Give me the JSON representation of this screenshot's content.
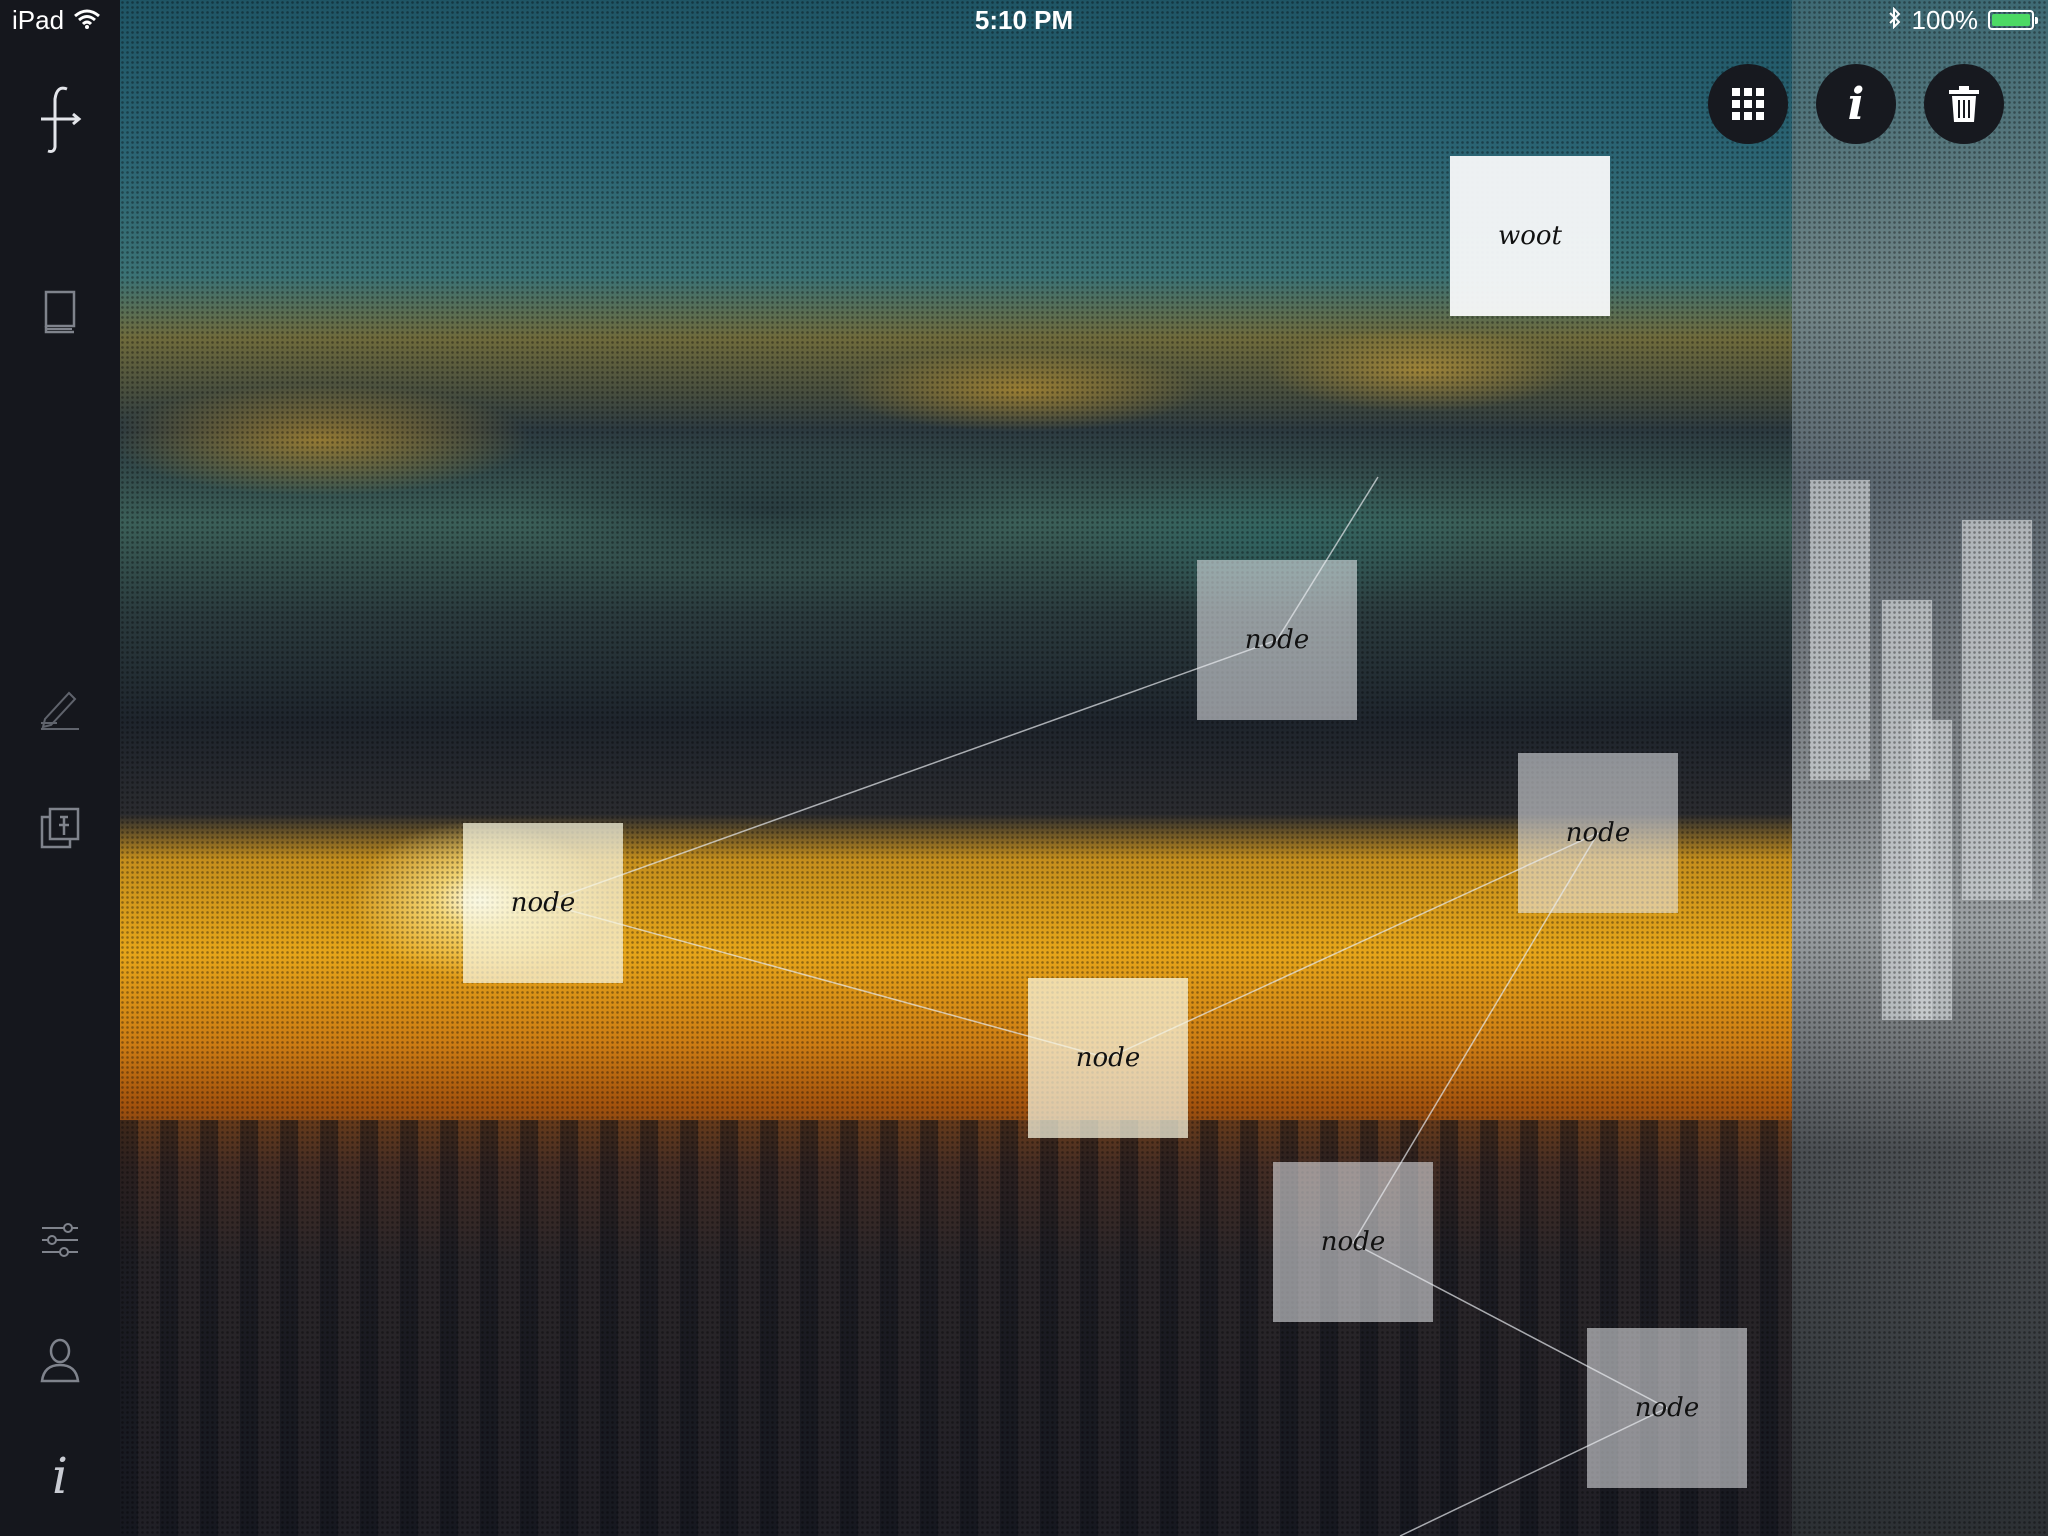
{
  "status_bar": {
    "device": "iPad",
    "time": "5:10 PM",
    "battery_percent": "100%",
    "battery_color": "#4cd964"
  },
  "sidebar": {
    "items": [
      {
        "icon": "logo-icon"
      },
      {
        "icon": "library-icon"
      },
      {
        "icon": "pen-icon"
      },
      {
        "icon": "pin-icon"
      },
      {
        "icon": "sliders-icon"
      },
      {
        "icon": "user-icon"
      },
      {
        "icon": "info-icon",
        "glyph": "i"
      }
    ]
  },
  "toolbar": {
    "grid_icon": "grid-icon",
    "info_glyph": "i",
    "trash_icon": "trash-icon"
  },
  "mindmap": {
    "root": {
      "label": "woot"
    },
    "nodes": [
      {
        "label": "node"
      },
      {
        "label": "node"
      },
      {
        "label": "node"
      },
      {
        "label": "node"
      },
      {
        "label": "node"
      },
      {
        "label": "node"
      }
    ]
  }
}
